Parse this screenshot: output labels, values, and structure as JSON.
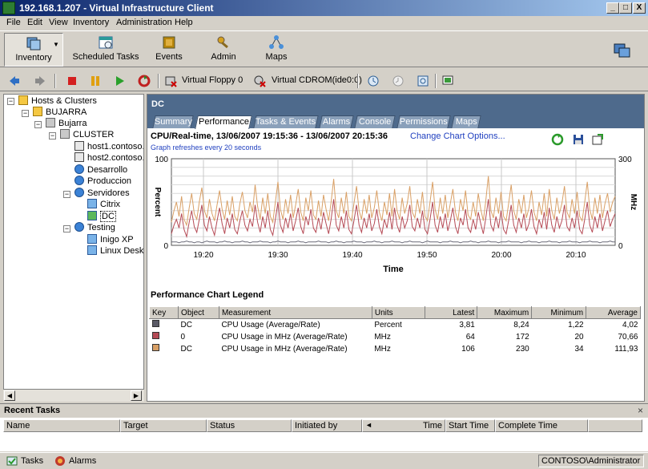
{
  "window": {
    "title": "192.168.1.207 - Virtual Infrastructure Client",
    "min": "_",
    "max": "□",
    "close": "X"
  },
  "menu": [
    "File",
    "Edit",
    "View",
    "Inventory",
    "Administration",
    "Help"
  ],
  "toolbar": {
    "inventory": "Inventory",
    "scheduled_tasks": "Scheduled Tasks",
    "events": "Events",
    "admin": "Admin",
    "maps": "Maps",
    "virtual_floppy": "Virtual Floppy 0",
    "virtual_cdrom": "Virtual CDROM(ide0:0)"
  },
  "tree": {
    "root": "Hosts & Clusters",
    "datacenter_folder": "BUJARRA",
    "datacenter": "Bujarra",
    "cluster": "CLUSTER",
    "host1": "host1.contoso.",
    "host2": "host2.contoso.",
    "pool_desarrollo": "Desarrollo",
    "pool_produccion": "Produccion",
    "pool_servidores": "Servidores",
    "vm_citrix": "Citrix",
    "vm_dc": "DC",
    "pool_testing": "Testing",
    "vm_inigo": "Inigo XP",
    "vm_linux": "Linux Deskt"
  },
  "main": {
    "object_name": "DC",
    "tabs": [
      "Summary",
      "Performance",
      "Tasks & Events",
      "Alarms",
      "Console",
      "Permissions",
      "Maps"
    ],
    "active_tab": "Performance",
    "chart_title": "CPU/Real-time, 13/06/2007 19:15:36 - 13/06/2007 20:15:36",
    "chart_link": "Change Chart Options...",
    "chart_subtitle": "Graph refreshes every 20 seconds",
    "legend_title": "Performance Chart Legend"
  },
  "chart_data": {
    "type": "line",
    "xlabel": "Time",
    "ylabel_left": "Percent",
    "ylabel_right": "MHz",
    "y_left_range": [
      0,
      100
    ],
    "y_right_range": [
      0,
      300
    ],
    "y_left_ticks": [
      "100",
      "0"
    ],
    "y_right_ticks": [
      "300",
      "0"
    ],
    "x_ticks": [
      "19:20",
      "19:30",
      "19:40",
      "19:50",
      "20:00",
      "20:10"
    ],
    "grid": true,
    "series": [
      {
        "name": "DC CPU Usage (Average/Rate) Percent",
        "color": "#6a6a78",
        "axis": "left",
        "values": [
          4,
          4,
          4,
          3,
          4,
          4,
          5,
          4,
          4,
          3,
          4,
          4,
          3,
          4,
          5,
          4,
          4,
          4,
          3,
          4,
          4,
          5,
          4,
          4,
          3,
          4,
          4,
          4,
          5,
          4,
          4,
          3,
          4,
          4,
          4,
          5,
          4,
          4,
          4,
          3,
          4,
          4,
          5,
          4,
          4,
          4,
          3,
          4,
          4,
          4,
          5,
          4,
          4,
          3,
          4,
          4,
          4,
          4,
          5,
          4,
          4,
          4,
          3,
          4,
          4,
          5,
          4,
          4,
          3,
          4,
          4,
          4,
          5,
          4,
          4,
          4,
          3,
          4,
          4,
          4,
          5,
          4,
          4,
          3,
          4,
          4,
          4,
          5,
          4,
          4,
          4,
          3,
          4,
          4,
          5,
          4,
          4,
          4,
          4,
          3,
          4,
          5,
          4,
          4,
          4,
          4,
          3,
          4,
          4,
          4,
          5,
          4,
          4,
          4,
          3,
          4,
          4,
          4,
          5,
          4,
          4,
          3,
          4,
          4,
          4,
          5,
          4,
          4,
          4,
          3,
          4,
          4,
          4,
          5,
          4,
          4,
          4,
          4,
          3,
          4,
          4,
          5,
          4,
          4,
          4,
          3,
          4,
          4,
          4,
          5,
          4,
          4,
          4,
          3,
          4,
          4,
          4,
          5,
          4,
          4,
          4,
          3,
          4,
          4,
          4,
          5,
          4,
          4,
          4,
          3,
          4,
          4,
          4,
          5,
          4,
          4
        ]
      },
      {
        "name": "0 CPU Usage in MHz (Average/Rate) MHz",
        "color": "#b54a55",
        "axis": "right",
        "values": [
          40,
          70,
          90,
          60,
          110,
          55,
          30,
          80,
          120,
          65,
          45,
          90,
          140,
          70,
          50,
          100,
          60,
          35,
          85,
          130,
          75,
          40,
          95,
          60,
          110,
          55,
          40,
          85,
          120,
          70,
          50,
          90,
          65,
          140,
          80,
          45,
          100,
          60,
          120,
          55,
          35,
          90,
          150,
          70,
          45,
          95,
          60,
          110,
          50,
          85,
          130,
          65,
          40,
          100,
          70,
          125,
          60,
          45,
          95,
          55,
          115,
          75,
          40,
          90,
          160,
          70,
          50,
          100,
          60,
          120,
          55,
          40,
          85,
          140,
          70,
          45,
          95,
          60,
          110,
          50,
          75,
          125,
          65,
          40,
          90,
          60,
          115,
          55,
          130,
          70,
          45,
          100,
          60,
          85,
          140,
          65,
          50,
          95,
          60,
          120,
          55,
          40,
          90,
          150,
          70,
          45,
          100,
          60,
          110,
          50,
          85,
          130,
          65,
          40,
          95,
          70,
          125,
          60,
          45,
          90,
          55,
          115,
          75,
          40,
          95,
          160,
          70,
          50,
          100,
          60,
          120,
          55,
          40,
          85,
          140,
          70,
          45,
          95,
          60,
          110,
          50,
          75,
          125,
          65,
          40,
          90,
          60,
          115,
          55,
          130,
          70,
          45,
          100,
          60,
          85,
          140,
          65,
          50,
          95,
          60,
          120,
          55,
          40,
          90,
          150,
          70,
          45,
          100,
          60,
          110,
          50,
          85,
          120,
          65,
          90,
          110
        ]
      },
      {
        "name": "DC CPU Usage in MHz (Average/Rate) MHz",
        "color": "#d9a066",
        "axis": "right",
        "values": [
          80,
          120,
          150,
          100,
          170,
          90,
          70,
          130,
          180,
          110,
          90,
          150,
          200,
          120,
          95,
          160,
          110,
          85,
          140,
          190,
          125,
          90,
          155,
          105,
          170,
          100,
          85,
          145,
          185,
          120,
          95,
          150,
          115,
          210,
          135,
          90,
          165,
          110,
          180,
          100,
          80,
          150,
          220,
          125,
          90,
          160,
          110,
          175,
          95,
          140,
          195,
          115,
          85,
          165,
          120,
          190,
          105,
          90,
          155,
          100,
          175,
          125,
          85,
          150,
          230,
          120,
          95,
          165,
          110,
          185,
          100,
          85,
          145,
          205,
          120,
          90,
          160,
          110,
          175,
          95,
          130,
          190,
          115,
          85,
          150,
          105,
          180,
          100,
          195,
          120,
          90,
          165,
          110,
          145,
          205,
          115,
          95,
          160,
          110,
          185,
          100,
          85,
          150,
          220,
          125,
          90,
          165,
          110,
          175,
          95,
          145,
          195,
          115,
          85,
          160,
          120,
          190,
          105,
          90,
          150,
          100,
          180,
          125,
          85,
          155,
          240,
          120,
          95,
          165,
          110,
          185,
          100,
          85,
          145,
          210,
          120,
          90,
          160,
          110,
          175,
          95,
          130,
          190,
          115,
          85,
          150,
          105,
          180,
          100,
          195,
          120,
          90,
          165,
          110,
          145,
          205,
          115,
          95,
          160,
          110,
          185,
          100,
          85,
          150,
          220,
          125,
          90,
          165,
          110,
          175,
          95,
          145,
          180,
          115,
          150,
          170
        ]
      }
    ]
  },
  "legend": {
    "headers": [
      "Key",
      "Object",
      "Measurement",
      "Units",
      "Latest",
      "Maximum",
      "Minimum",
      "Average"
    ],
    "rows": [
      {
        "color": "#5a5a66",
        "object": "DC",
        "measurement": "CPU Usage (Average/Rate)",
        "units": "Percent",
        "latest": "3,81",
        "maximum": "8,24",
        "minimum": "1,22",
        "average": "4,02"
      },
      {
        "color": "#b54a55",
        "object": "0",
        "measurement": "CPU Usage in MHz (Average/Rate)",
        "units": "MHz",
        "latest": "64",
        "maximum": "172",
        "minimum": "20",
        "average": "70,66"
      },
      {
        "color": "#d9a066",
        "object": "DC",
        "measurement": "CPU Usage in MHz (Average/Rate)",
        "units": "MHz",
        "latest": "106",
        "maximum": "230",
        "minimum": "34",
        "average": "111,93"
      }
    ]
  },
  "recent_tasks": {
    "title": "Recent Tasks",
    "close": "×",
    "columns": [
      "Name",
      "Target",
      "Status",
      "Initiated by",
      "Time",
      "Start Time",
      "Complete Time"
    ]
  },
  "statusbar": {
    "tasks": "Tasks",
    "alarms": "Alarms",
    "user": "CONTOSO\\Administrator"
  }
}
